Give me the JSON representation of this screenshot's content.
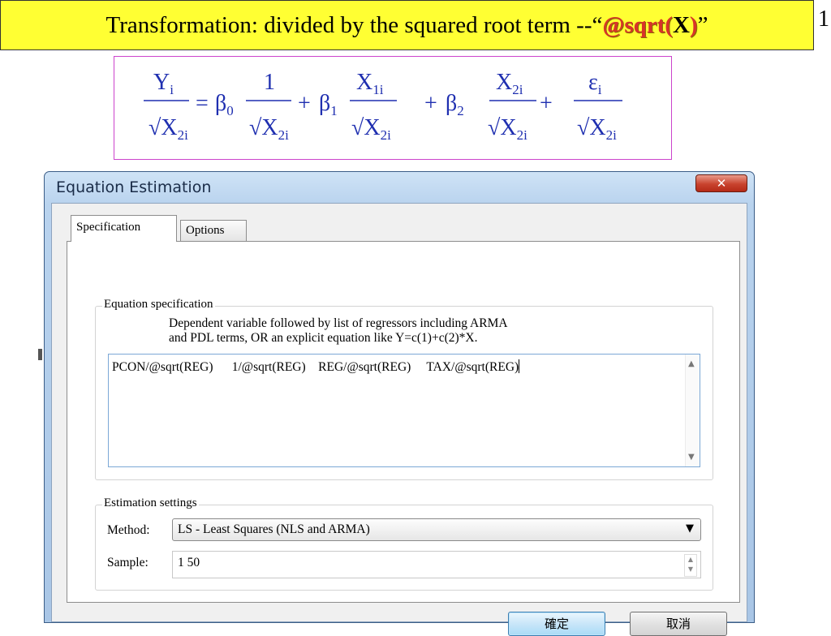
{
  "slide": {
    "banner_prefix": "Transformation: divided by the squared root term --“",
    "banner_code_open": "@sqrt(",
    "banner_code_x": "X",
    "banner_code_close": ")",
    "banner_suffix": "”",
    "page_number": "1"
  },
  "formula": {
    "terms": [
      {
        "num": "Y",
        "num_sub": "i",
        "den": "√X",
        "den_sub": "2i"
      },
      {
        "coef": "β",
        "coef_sub": "0",
        "num": "1",
        "num_sub": "",
        "den": "√X",
        "den_sub": "2i"
      },
      {
        "coef": "β",
        "coef_sub": "1",
        "num": "X",
        "num_sub": "1i",
        "den": "√X",
        "den_sub": "2i"
      },
      {
        "coef": "β",
        "coef_sub": "2",
        "num": "X",
        "num_sub": "2i",
        "den": "√X",
        "den_sub": "2i"
      },
      {
        "num": "ε",
        "num_sub": "i",
        "den": "√X",
        "den_sub": "2i"
      }
    ],
    "equals": "=",
    "plus": "+"
  },
  "dialog": {
    "title": "Equation Estimation",
    "close_glyph": "✕",
    "tabs": [
      {
        "label": "Specification",
        "active": true
      },
      {
        "label": "Options",
        "active": false
      }
    ],
    "equation_spec": {
      "legend": "Equation specification",
      "hint_line1": "Dependent variable followed by list of regressors including ARMA",
      "hint_line2": "and PDL terms, OR an explicit equation like Y=c(1)+c(2)*X.",
      "value": "PCON/@sqrt(REG)      1/@sqrt(REG)    REG/@sqrt(REG)     TAX/@sqrt(REG)"
    },
    "estimation_settings": {
      "legend": "Estimation settings",
      "method_label": "Method:",
      "method_value": "LS  -  Least Squares (NLS and ARMA)",
      "sample_label": "Sample:",
      "sample_value": "1 50"
    },
    "buttons": {
      "ok": "確定",
      "cancel": "取消"
    }
  },
  "colors": {
    "banner_bg": "#ffff33",
    "code_red": "#d8332a",
    "formula_blue": "#1f2fb0",
    "arrow_red": "#e8361b"
  }
}
